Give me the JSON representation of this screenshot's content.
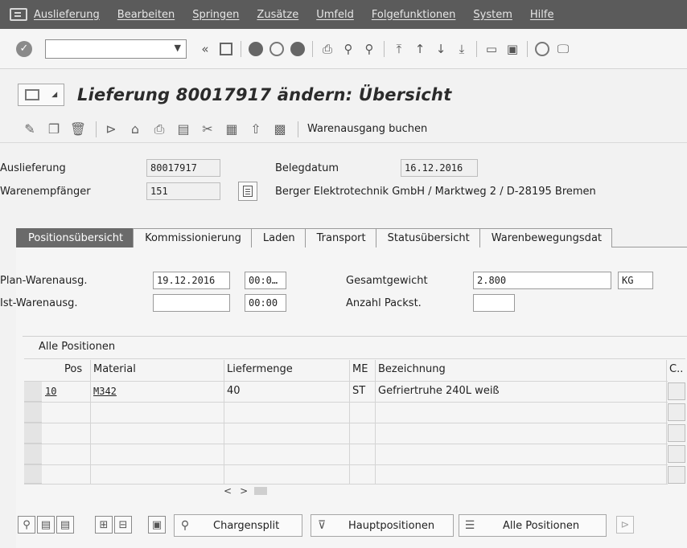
{
  "menubar": {
    "items": [
      "Auslieferung",
      "Bearbeiten",
      "Springen",
      "Zusätze",
      "Umfeld",
      "Folgefunktionen",
      "System",
      "Hilfe"
    ]
  },
  "systoolbar": {
    "command_value": ""
  },
  "title": {
    "text": "Lieferung 80017917 ändern: Übersicht"
  },
  "apptoolbar": {
    "post_goods_issue_label": "Warenausgang buchen"
  },
  "header": {
    "delivery_label": "Auslieferung",
    "delivery_value": "80017917",
    "doc_date_label": "Belegdatum",
    "doc_date_value": "16.12.2016",
    "ship_to_label": "Warenempfänger",
    "ship_to_value": "151",
    "ship_to_address": "Berger Elektrotechnik GmbH / Marktweg 2 / D-28195 Bremen"
  },
  "tabs": [
    {
      "label": "Positionsübersicht",
      "active": true
    },
    {
      "label": "Kommissionierung",
      "active": false
    },
    {
      "label": "Laden",
      "active": false
    },
    {
      "label": "Transport",
      "active": false
    },
    {
      "label": "Statusübersicht",
      "active": false
    },
    {
      "label": "Warenbewegungsdat",
      "active": false
    }
  ],
  "overview": {
    "plan_gi_label": "Plan-Warenausg.",
    "plan_gi_date": "19.12.2016",
    "plan_gi_time": "00:0…",
    "actual_gi_label": "Ist-Warenausg.",
    "actual_gi_date": "",
    "actual_gi_time": "00:00",
    "total_weight_label": "Gesamtgewicht",
    "total_weight_value": "2.800",
    "weight_unit": "KG",
    "packages_label": "Anzahl Packst.",
    "packages_value": ""
  },
  "table": {
    "title": "Alle Positionen",
    "columns": [
      "Pos",
      "Material",
      "Liefermenge",
      "ME",
      "Bezeichnung",
      "C.."
    ],
    "rows": [
      {
        "pos": "10",
        "material": "M342",
        "quantity": "40",
        "unit": "ST",
        "description": "Gefriertruhe 240L weiß"
      }
    ]
  },
  "bottombar": {
    "batch_split_label": "Chargensplit",
    "main_items_label": "Hauptpositionen",
    "all_items_label": "Alle Positionen"
  }
}
